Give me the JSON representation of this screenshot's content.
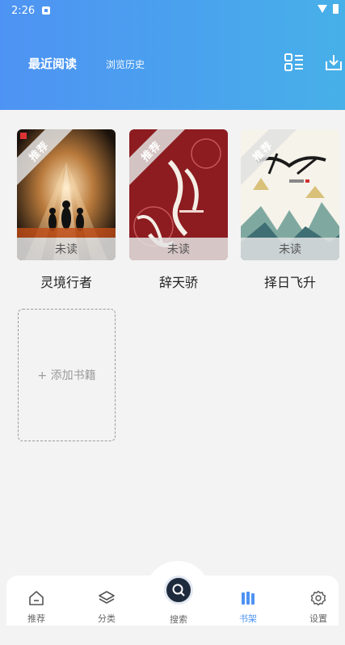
{
  "status_bar": {
    "time": "2:26"
  },
  "header": {
    "tabs": [
      {
        "label": "最近阅读",
        "active": true
      },
      {
        "label": "浏览历史",
        "active": false
      }
    ]
  },
  "books": [
    {
      "title": "灵境行者",
      "ribbon": "推荐",
      "status": "未读"
    },
    {
      "title": "辞天骄",
      "ribbon": "推荐",
      "status": "未读"
    },
    {
      "title": "择日飞升",
      "ribbon": "推荐",
      "status": "未读"
    }
  ],
  "add_book": {
    "label": "+ 添加书籍"
  },
  "bottom_nav": {
    "items": [
      {
        "label": "推荐",
        "icon": "home-icon"
      },
      {
        "label": "分类",
        "icon": "layers-icon"
      },
      {
        "label": "搜索",
        "icon": "search-icon"
      },
      {
        "label": "书架",
        "icon": "bookshelf-icon",
        "active": true
      },
      {
        "label": "设置",
        "icon": "gear-icon"
      }
    ]
  },
  "colors": {
    "accent": "#4e93f3",
    "header_end": "#47b0e8"
  }
}
